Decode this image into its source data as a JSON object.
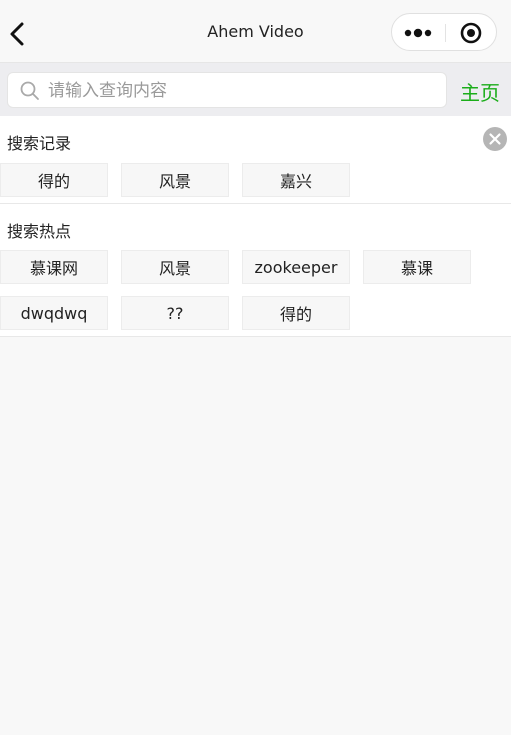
{
  "nav": {
    "title": "Ahem Video",
    "back_icon": "chevron-left-icon",
    "more_icon": "more-dots-icon",
    "close_icon": "target-icon"
  },
  "search": {
    "placeholder": "请输入查询内容",
    "value": "",
    "home_label": "主页"
  },
  "history": {
    "title": "搜索记录",
    "items": [
      "得的",
      "风景",
      "嘉兴"
    ]
  },
  "hot": {
    "title": "搜索热点",
    "items": [
      "慕课网",
      "风景",
      "zookeeper",
      "慕课",
      "dwqdwq",
      "??",
      "得的"
    ]
  },
  "colors": {
    "accent": "#1aad19",
    "background": "#f8f8f8",
    "tag_bg": "#f7f7f7"
  }
}
